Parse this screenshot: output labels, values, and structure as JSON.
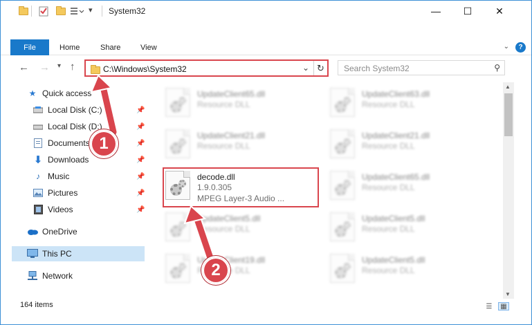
{
  "window": {
    "title": "System32",
    "controls": {
      "minimize": "—",
      "maximize": "☐",
      "close": "✕"
    }
  },
  "ribbon": {
    "file_tab": "File",
    "tabs": [
      "Home",
      "Share",
      "View"
    ],
    "help": "?"
  },
  "navigation": {
    "address": "C:\\Windows\\System32",
    "search_placeholder": "Search System32"
  },
  "sidebar": {
    "items": [
      {
        "label": "Quick access",
        "icon": "star-icon"
      },
      {
        "label": "Local Disk (C:)",
        "icon": "drive-icon",
        "pinned": true
      },
      {
        "label": "Local Disk (D:)",
        "icon": "drive-icon",
        "pinned": true
      },
      {
        "label": "Documents",
        "icon": "documents-icon",
        "pinned": true
      },
      {
        "label": "Downloads",
        "icon": "download-icon",
        "pinned": true
      },
      {
        "label": "Music",
        "icon": "music-icon",
        "pinned": true
      },
      {
        "label": "Pictures",
        "icon": "pictures-icon",
        "pinned": true
      },
      {
        "label": "Videos",
        "icon": "videos-icon",
        "pinned": true
      },
      {
        "label": "OneDrive",
        "icon": "cloud-icon"
      },
      {
        "label": "This PC",
        "icon": "computer-icon",
        "selected": true
      },
      {
        "label": "Network",
        "icon": "network-icon"
      }
    ]
  },
  "files": [
    {
      "name": "UpdateClient65.dll",
      "type": "Resource DLL",
      "blurred": true
    },
    {
      "name": "UpdateClient63.dll",
      "type": "Resource DLL",
      "blurred": true
    },
    {
      "name": "UpdateClient21.dll",
      "type": "Resource DLL",
      "blurred": true
    },
    {
      "name": "UpdateClient21.dll",
      "type": "Resource DLL",
      "blurred": true
    },
    {
      "name": "decode.dll",
      "version": "1.9.0.305",
      "type": "MPEG Layer-3 Audio ...",
      "blurred": false
    },
    {
      "name": "UpdateClient65.dll",
      "type": "Resource DLL",
      "blurred": true
    },
    {
      "name": "UpdateClient5.dll",
      "type": "Resource DLL",
      "blurred": true
    },
    {
      "name": "UpdateClient5.dll",
      "type": "Resource DLL",
      "blurred": true
    },
    {
      "name": "UpdateClient19.dll",
      "type": "Resource DLL",
      "blurred": true
    },
    {
      "name": "UpdateClient5.dll",
      "type": "Resource DLL",
      "blurred": true
    }
  ],
  "status": {
    "item_count": "164 items"
  },
  "annotations": {
    "step1": "1",
    "step2": "2"
  },
  "colors": {
    "accent": "#1979ca",
    "highlight": "#d9454d",
    "selection": "#cce4f7"
  }
}
